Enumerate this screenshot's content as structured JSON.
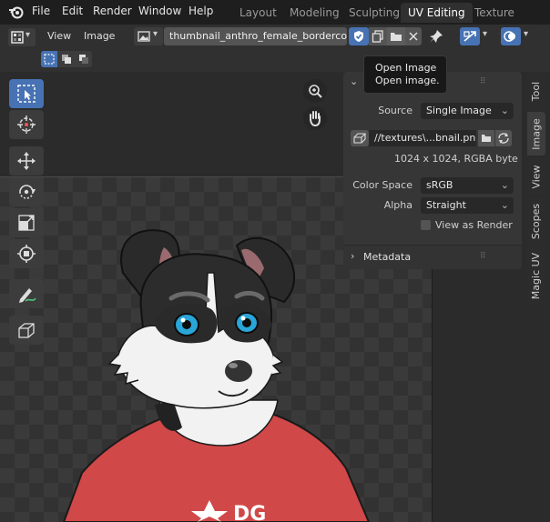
{
  "menu": {
    "items": [
      "File",
      "Edit",
      "Render",
      "Window",
      "Help"
    ]
  },
  "workspaces": {
    "tabs": [
      "Layout",
      "Modeling",
      "Sculpting",
      "UV Editing",
      "Texture Paint"
    ],
    "active": "UV Editing"
  },
  "header": {
    "view_label": "View",
    "image_label": "Image",
    "image_name": "thumbnail_anthro_female_bordercollie"
  },
  "tooltip": {
    "title": "Open Image",
    "description": "Open image."
  },
  "image_panel": {
    "source_label": "Source",
    "source_value": "Single Image",
    "filepath": "//textures\\...bnail.png",
    "info": "1024 x 1024,  RGBA byte",
    "color_space_label": "Color Space",
    "color_space_value": "sRGB",
    "alpha_label": "Alpha",
    "alpha_value": "Straight",
    "view_as_render_label": "View as Render",
    "view_as_render_checked": false,
    "metadata_label": "Metadata"
  },
  "side_tabs": [
    "Tool",
    "Image",
    "View",
    "Scopes",
    "Magic UV"
  ],
  "active_side_tab": "Image",
  "colors": {
    "accent": "#4772b3",
    "shirt": "#d04848",
    "eye": "#2aa5d8"
  }
}
